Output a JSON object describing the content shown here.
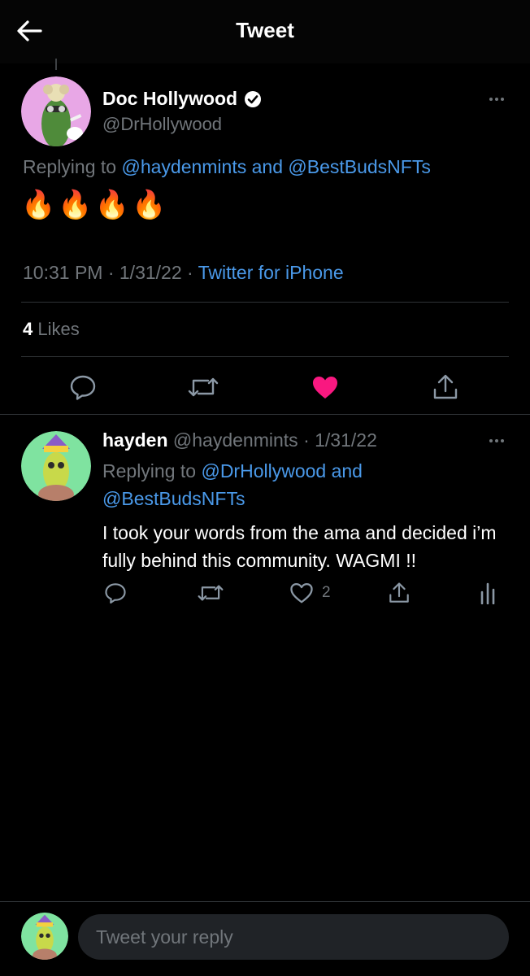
{
  "header": {
    "title": "Tweet",
    "back_icon": "arrow-left-icon"
  },
  "tweet": {
    "author_name": "Doc Hollywood",
    "verified": true,
    "handle": "@DrHollywood",
    "replying_prefix": "Replying to ",
    "replying_user1": "@haydenmints",
    "replying_and": " and ",
    "replying_user2": "@BestBudsNFTs",
    "content": "🔥🔥🔥🔥",
    "time": "10:31 PM · 1/31/22 · ",
    "source": "Twitter for iPhone",
    "likes_count": "4",
    "likes_label": " Likes",
    "liked": true
  },
  "reply": {
    "author_name": "hayden",
    "handle_date": " @haydenmints · 1/31/22",
    "replying_prefix": "Replying to ",
    "replying_users": "@DrHollywood and @BestBudsNFTs",
    "text": "I took your words from the ama and decided i’m fully behind this community. WAGMI !!",
    "like_count": "2"
  },
  "compose": {
    "placeholder": "Tweet your reply"
  },
  "colors": {
    "accent": "#4a99e9",
    "like": "#f91880",
    "muted": "#71767b",
    "background": "#000000"
  }
}
